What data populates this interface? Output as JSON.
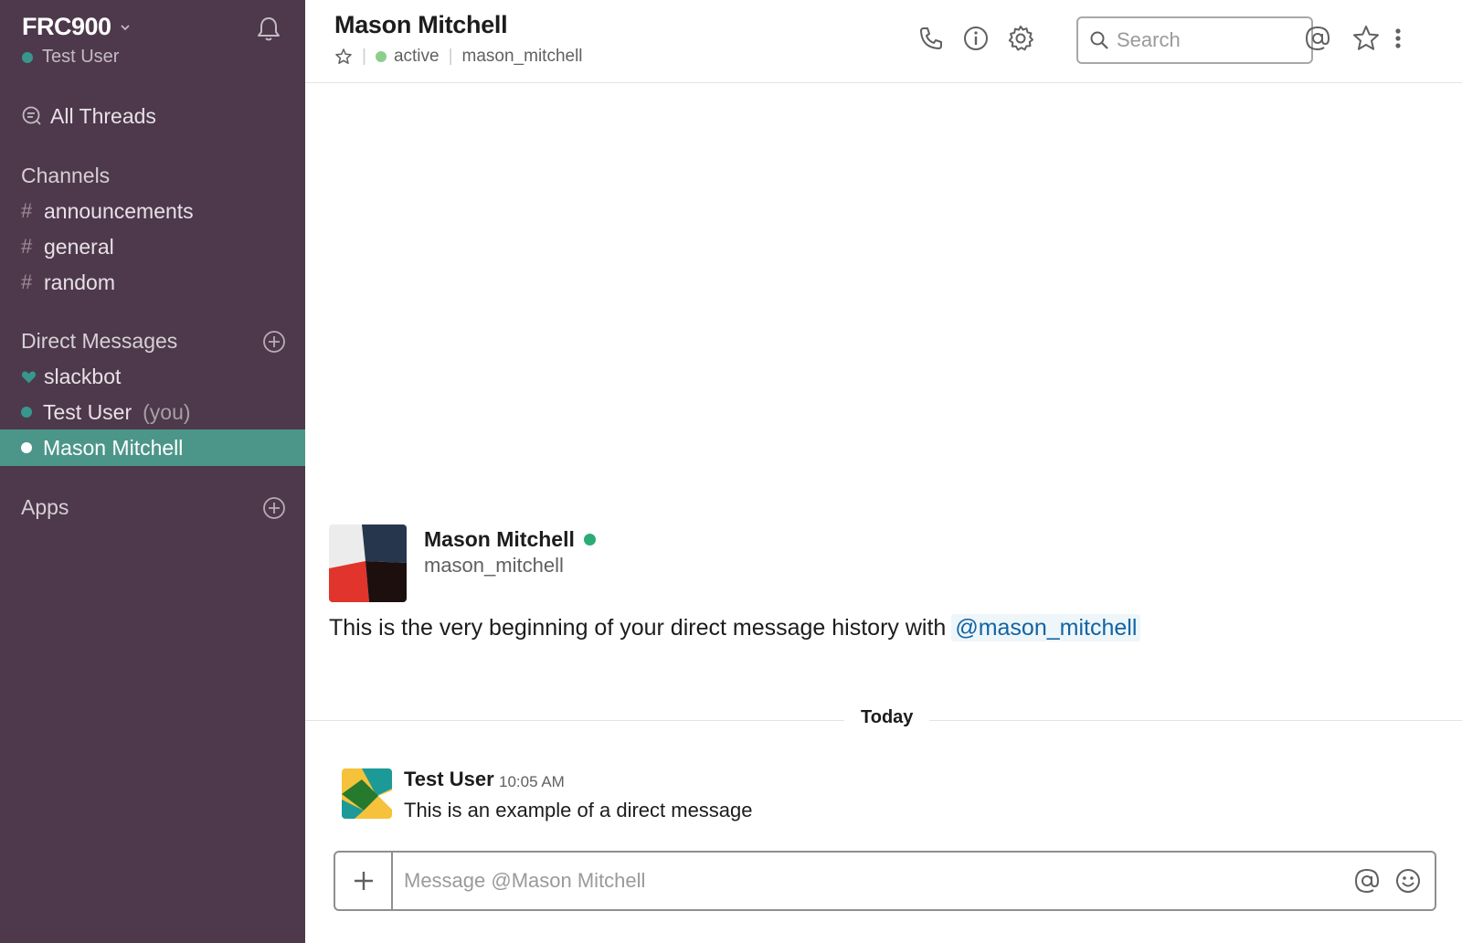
{
  "team": {
    "name": "FRC900",
    "user": "Test User"
  },
  "sidebar": {
    "all_threads": "All Threads",
    "channels_header": "Channels",
    "channels": [
      "announcements",
      "general",
      "random"
    ],
    "dm_header": "Direct Messages",
    "dms": [
      {
        "name": "slackbot",
        "suffix": ""
      },
      {
        "name": "Test User",
        "suffix": "(you)"
      },
      {
        "name": "Mason Mitchell",
        "suffix": ""
      }
    ],
    "apps_header": "Apps"
  },
  "header": {
    "title": "Mason Mitchell",
    "status": "active",
    "handle": "mason_mitchell",
    "search_placeholder": "Search"
  },
  "intro": {
    "name": "Mason Mitchell",
    "handle": "mason_mitchell",
    "text": "This is the very beginning of your direct message history with",
    "mention": "@mason_mitchell"
  },
  "divider": "Today",
  "message": {
    "author": "Test User",
    "time": "10:05 AM",
    "text": "This is an example of a direct message"
  },
  "composer": {
    "placeholder": "Message @Mason Mitchell"
  },
  "colors": {
    "sidebar_bg": "#4d394b",
    "active_item": "#4c9689",
    "presence_green": "#2bac76",
    "mention_blue": "#1264a3"
  },
  "icons": [
    "bell-icon",
    "threads-icon",
    "plus-circle-icon",
    "heart-icon",
    "phone-icon",
    "info-icon",
    "gear-icon",
    "search-icon",
    "at-icon",
    "star-icon",
    "kebab-icon",
    "emoji-icon"
  ]
}
